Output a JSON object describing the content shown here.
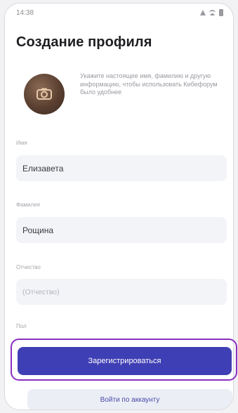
{
  "status_bar": {
    "time": "14:38",
    "icons": [
      "signal-icon",
      "wifi-icon",
      "battery-icon"
    ]
  },
  "header": {
    "title": "Создание профиля"
  },
  "avatar": {
    "icon": "camera-icon",
    "hint": "Укажите настоящее имя, фамилию и другую информацию, чтобы использовать Кибефорум было удобнее"
  },
  "form": {
    "first_name": {
      "label": "Имя",
      "value": "Елизавета"
    },
    "last_name": {
      "label": "Фамилия",
      "value": "Рощина"
    },
    "patronymic": {
      "label": "Отчество",
      "placeholder": "(Отчество)"
    },
    "gender": {
      "label": "Пол"
    }
  },
  "actions": {
    "register_label": "Зарегистрироваться",
    "login_label": "Войти по аккаунту"
  },
  "colors": {
    "primary": "#3f3fb5",
    "highlight": "#8a2fc0",
    "field_bg": "#f3f4f8"
  }
}
